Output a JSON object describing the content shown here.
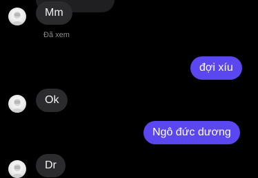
{
  "conversation": {
    "messages": [
      {
        "direction": "incoming",
        "text": "Mm"
      },
      {
        "direction": "outgoing",
        "text": "đợi xíu"
      },
      {
        "direction": "incoming",
        "text": "Ok"
      },
      {
        "direction": "outgoing",
        "text": "Ngô đức dương"
      },
      {
        "direction": "incoming",
        "text": "Dr"
      }
    ],
    "seen_status": "Đã xem"
  },
  "colors": {
    "background": "#000000",
    "incoming_bubble": "#2b2b2d",
    "outgoing_bubble": "#5a47f0",
    "seen_text": "#8a8a8e"
  },
  "icons": {
    "avatar": "contact-avatar-icon"
  }
}
